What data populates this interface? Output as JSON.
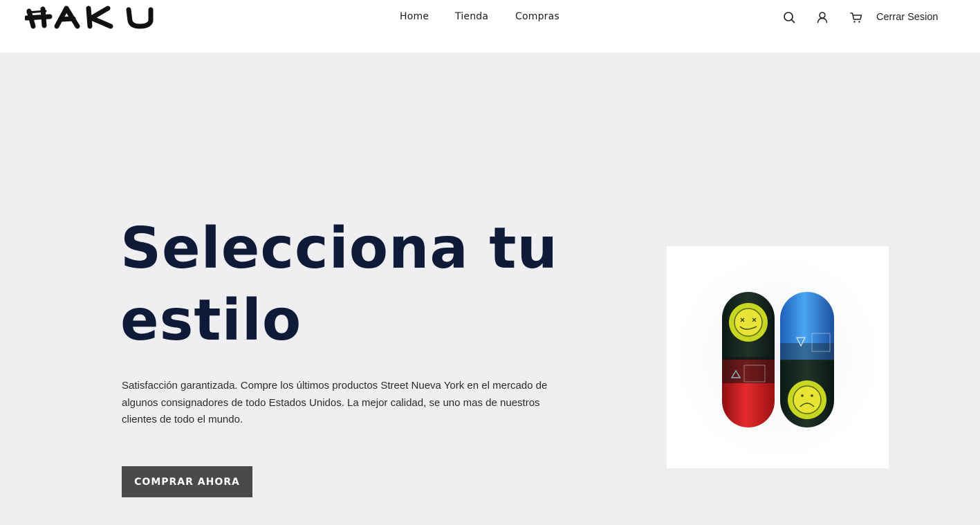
{
  "header": {
    "logo_text": "HAKU",
    "nav": [
      {
        "label": "Home"
      },
      {
        "label": "Tienda"
      },
      {
        "label": "Compras"
      }
    ],
    "icons": [
      "search-icon",
      "user-icon",
      "cart-icon"
    ],
    "logout_label": "Cerrar Sesion"
  },
  "hero": {
    "title": "Selecciona tu estilo",
    "description": "Satisfacción garantizada. Compre los últimos productos Street Nueva York en el mercado de algunos consignadores de todo Estados Unidos. La mejor calidad, se uno mas de nuestros clientes de todo el mundo.",
    "cta_label": "COMPRAR AHORA"
  },
  "colors": {
    "page_background": "#efeff1",
    "header_background": "#ffffff",
    "title": "#0f1a38",
    "cta_background": "#4a4a4a",
    "cta_text": "#ffffff"
  }
}
